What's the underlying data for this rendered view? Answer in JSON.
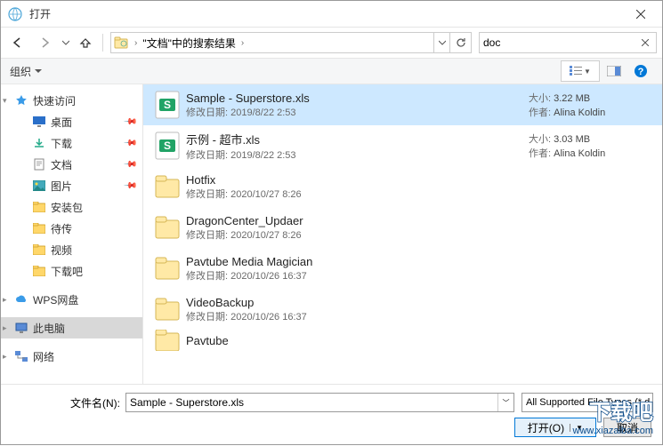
{
  "window": {
    "title": "打开"
  },
  "nav": {
    "breadcrumb": "\"文档\"中的搜索结果",
    "search_value": "doc"
  },
  "toolbar": {
    "organize": "组织"
  },
  "sidebar": {
    "quick_access": "快速访问",
    "items": [
      {
        "label": "桌面"
      },
      {
        "label": "下载"
      },
      {
        "label": "文档"
      },
      {
        "label": "图片"
      },
      {
        "label": "安装包"
      },
      {
        "label": "待传"
      },
      {
        "label": "视频"
      },
      {
        "label": "下载吧"
      }
    ],
    "wps": "WPS网盘",
    "this_pc": "此电脑",
    "network": "网络"
  },
  "files": {
    "mod_label": "修改日期:",
    "size_label": "大小:",
    "author_label": "作者:",
    "rows": [
      {
        "name": "Sample - Superstore.xls",
        "mod": "2019/8/22 2:53",
        "size": "3.22 MB",
        "author": "Alina Koldin",
        "type": "xls"
      },
      {
        "name": "示例 - 超市.xls",
        "mod": "2019/8/22 2:53",
        "size": "3.03 MB",
        "author": "Alina Koldin",
        "type": "xls"
      },
      {
        "name": "Hotfix",
        "mod": "2020/10/27 8:26",
        "type": "folder"
      },
      {
        "name": "DragonCenter_Updaer",
        "mod": "2020/10/27 8:26",
        "type": "folder"
      },
      {
        "name": "Pavtube Media Magician",
        "mod": "2020/10/26 16:37",
        "type": "folder"
      },
      {
        "name": "VideoBackup",
        "mod": "2020/10/26 16:37",
        "type": "folder"
      },
      {
        "name": "Pavtube",
        "mod": "",
        "type": "folder"
      }
    ]
  },
  "bottom": {
    "filename_label": "文件名(N):",
    "filename_value": "Sample - Superstore.xls",
    "filter_label": "All Supported File Types (*.d…",
    "open_btn": "打开(O)",
    "cancel_btn": "取消"
  },
  "watermark": {
    "line1": "下载吧",
    "line2": "www.xiazaiba.com"
  }
}
